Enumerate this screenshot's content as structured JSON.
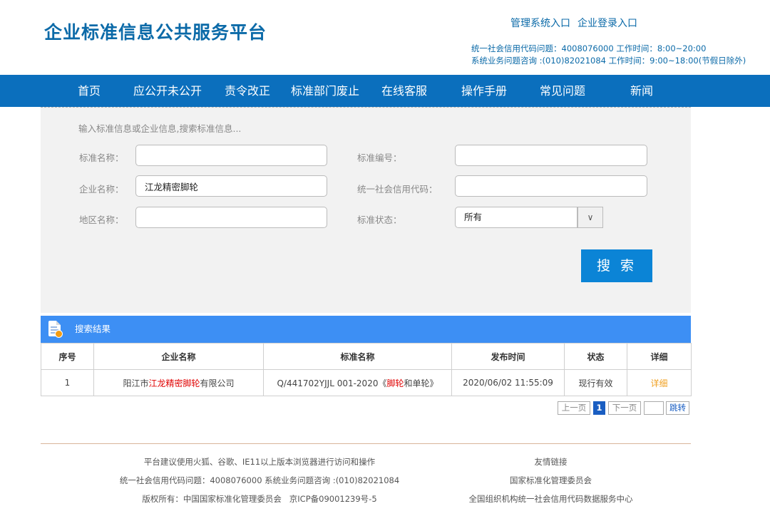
{
  "header": {
    "site_title": "企业标准信息公共服务平台",
    "admin_entry": "管理系统入口",
    "enterprise_login": "企业登录入口",
    "contact_line1": "统一社会信用代码问题：4008076000 工作时间：8:00~20:00",
    "contact_line2": "系统业务问题咨询 :(010)82021084 工作时间：9:00~18:00(节假日除外)"
  },
  "nav": {
    "items": [
      "首页",
      "应公开未公开",
      "责令改正",
      "标准部门废止",
      "在线客服",
      "操作手册",
      "常见问题",
      "新闻"
    ]
  },
  "search": {
    "hint": "输入标准信息或企业信息,搜索标准信息...",
    "std_name_label": "标准名称：",
    "std_name_value": "",
    "std_code_label": "标准编号：",
    "std_code_value": "",
    "company_label": "企业名称：",
    "company_value": "江龙精密脚轮",
    "credit_label": "统一社会信用代码：",
    "credit_value": "",
    "region_label": "地区名称：",
    "region_value": "",
    "status_label": "标准状态：",
    "status_value": "所有",
    "dropdown_glyph": "∨",
    "button": "搜 索"
  },
  "results": {
    "title": "搜索结果",
    "columns": [
      "序号",
      "企业名称",
      "标准名称",
      "发布时间",
      "状态",
      "详细"
    ],
    "rows": [
      {
        "index": "1",
        "company_prefix": "阳江市",
        "company_highlight": "江龙精密脚轮",
        "company_suffix": "有限公司",
        "std_prefix": "Q/441702YJJL 001-2020《",
        "std_highlight": "脚轮",
        "std_suffix": "和单轮》",
        "publish_time": "2020/06/02 11:55:09",
        "status": "现行有效",
        "detail": "详细"
      }
    ]
  },
  "pagination": {
    "prev": "上一页",
    "current": "1",
    "next": "下一页",
    "jump": "跳转"
  },
  "footer": {
    "browser_note": "平台建议使用火狐、谷歌、IE11以上版本浏览器进行访问和操作",
    "contact": "统一社会信用代码问题：4008076000 系统业务问题咨询 :(010)82021084",
    "copyright": "版权所有：中国国家标准化管理委员会   京ICP备09001239号-5",
    "links_title": "友情链接",
    "link1": "国家标准化管理委员会",
    "link2": "全国组织机构统一社会信用代码数据服务中心"
  },
  "colors": {
    "brand_blue": "#0b6aa8",
    "nav_blue": "#0b6fbd",
    "results_header": "#3d8ff4",
    "highlight_red": "#e00000",
    "detail_orange": "#f0a020"
  }
}
